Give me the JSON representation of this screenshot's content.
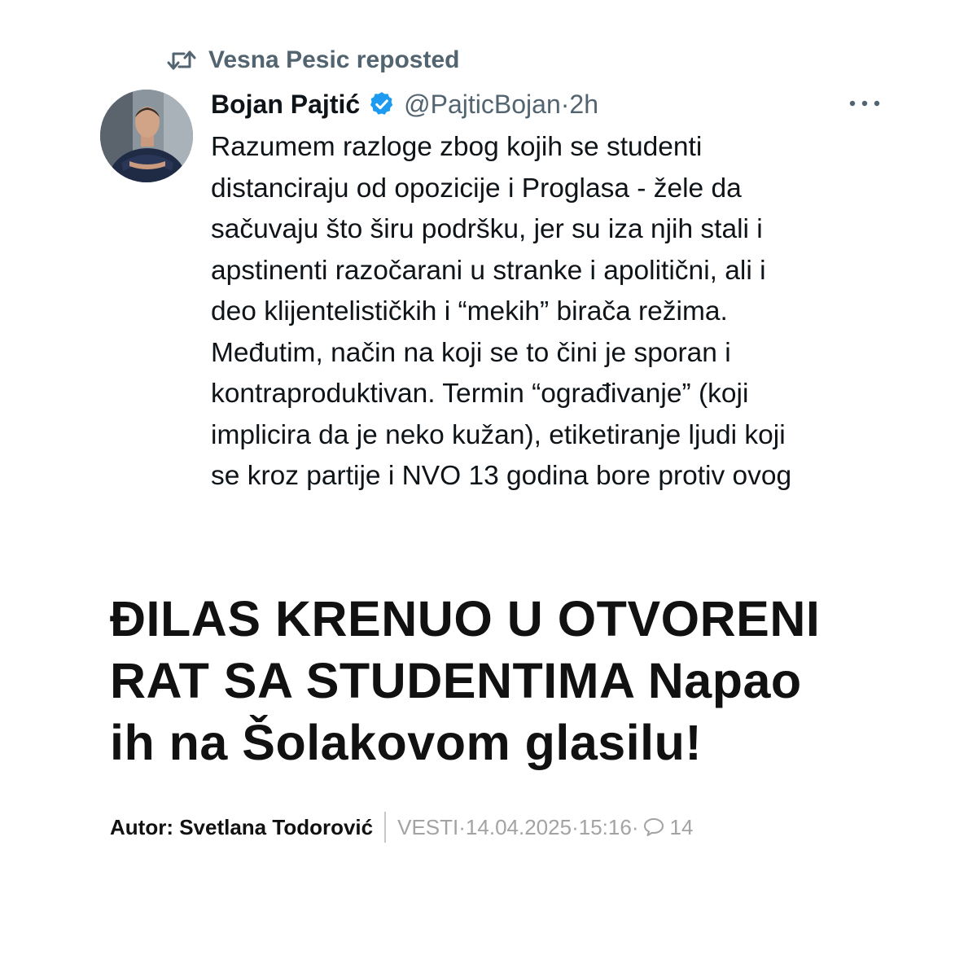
{
  "repost": {
    "label": "Vesna Pesic reposted",
    "icon": "repost-icon"
  },
  "tweet": {
    "author_name": "Bojan Pajtić",
    "verified": true,
    "handle": "@PajticBojan",
    "separator": "·",
    "time": "2h",
    "more_icon": "more-options-icon",
    "text_lines": [
      "Razumem razloge zbog kojih se studenti",
      "distanciraju od opozicije i Proglasa - žele da",
      "sačuvaju što širu podršku, jer su iza njih stali i",
      "apstinenti razočarani u stranke i apolitični, ali i",
      "deo klijentelističkih i “mekih” birača režima.",
      "Međutim, način na koji se to čini je sporan i",
      "kontraproduktivan. Termin “ograđivanje” (koji",
      "implicira da je neko kužan), etiketiranje ljudi koji",
      "se kroz partije i NVO 13 godina bore protiv ovog"
    ]
  },
  "article": {
    "headline_lines": [
      "ĐILAS KRENUO U OTVORENI",
      "RAT SA STUDENTIMA Napao",
      "ih na Šolakovom glasilu!"
    ],
    "byline": "Autor: Svetlana Todorović",
    "category": "VESTI",
    "date": "14.04.2025",
    "time": "15:16",
    "comments_count": "14",
    "separator": " · "
  },
  "colors": {
    "text": "#0f1419",
    "muted": "#536471",
    "verified": "#1d9bf0",
    "meta_muted": "#a3a3a3"
  }
}
